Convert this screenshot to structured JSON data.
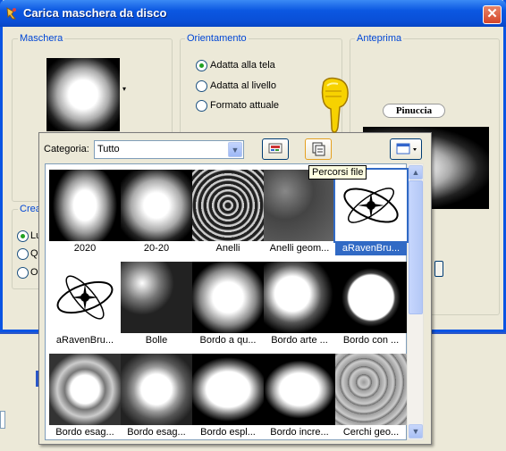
{
  "window": {
    "title": "Carica maschera da disco"
  },
  "groups": {
    "maschera": "Maschera",
    "orientamento": "Orientamento",
    "anteprima": "Anteprima",
    "crea": "Crea"
  },
  "orientation_options": [
    {
      "label": "Adatta alla tela",
      "checked": true
    },
    {
      "label": "Adatta al livello",
      "checked": false
    },
    {
      "label": "Formato attuale",
      "checked": false
    }
  ],
  "crea_options": [
    {
      "label": "Lu",
      "checked": true
    },
    {
      "label": "Qu",
      "checked": false
    },
    {
      "label": "Op",
      "checked": false
    }
  ],
  "preview_badge": "Pinuccia",
  "dropdown": {
    "category_label": "Categoria:",
    "category_value": "Tutto",
    "tooltip": "Percorsi file"
  },
  "thumbnails": [
    {
      "label": "2020",
      "selected": false
    },
    {
      "label": "20-20",
      "selected": false
    },
    {
      "label": "Anelli",
      "selected": false
    },
    {
      "label": "Anelli geom...",
      "selected": false
    },
    {
      "label": "aRavenBru...",
      "selected": true
    },
    {
      "label": "aRavenBru...",
      "selected": false
    },
    {
      "label": "Bolle",
      "selected": false
    },
    {
      "label": "Bordo a qu...",
      "selected": false
    },
    {
      "label": "Bordo arte ...",
      "selected": false
    },
    {
      "label": "Bordo con ...",
      "selected": false
    },
    {
      "label": "Bordo esag...",
      "selected": false
    },
    {
      "label": "Bordo esag...",
      "selected": false
    },
    {
      "label": "Bordo espl...",
      "selected": false
    },
    {
      "label": "Bordo incre...",
      "selected": false
    },
    {
      "label": "Cerchi geo...",
      "selected": false
    }
  ],
  "colors": {
    "accent": "#316ac5",
    "titlebar": "#0a54e3",
    "group_label": "#0046d5"
  }
}
